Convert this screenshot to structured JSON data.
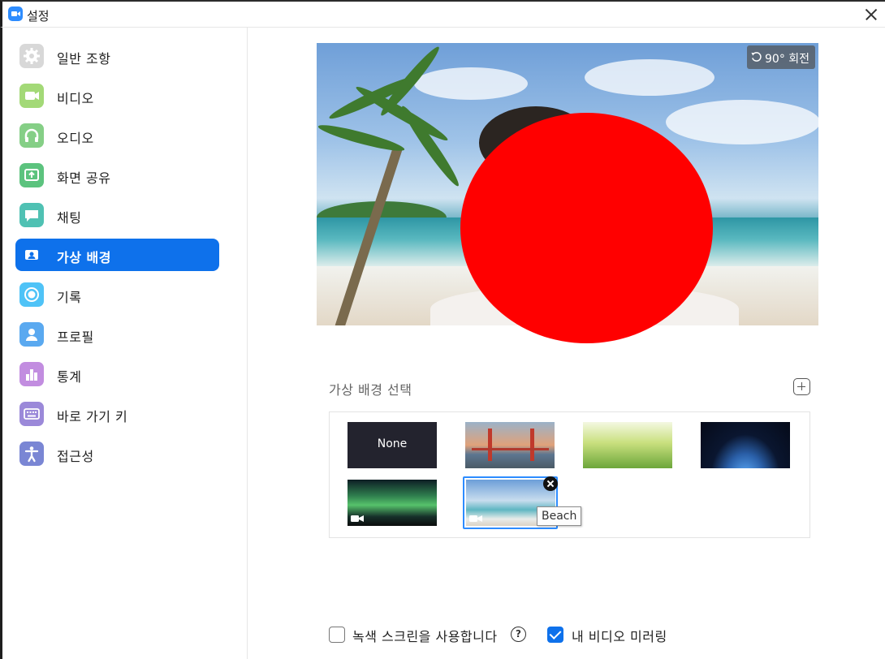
{
  "window": {
    "title": "설정"
  },
  "sidebar": {
    "items": [
      {
        "label": "일반 조항",
        "icon": "gear-icon",
        "active": false
      },
      {
        "label": "비디오",
        "icon": "video-icon",
        "active": false
      },
      {
        "label": "오디오",
        "icon": "headphones-icon",
        "active": false
      },
      {
        "label": "화면 공유",
        "icon": "screen-share-icon",
        "active": false
      },
      {
        "label": "채팅",
        "icon": "chat-bubble-icon",
        "active": false
      },
      {
        "label": "가상 배경",
        "icon": "virtual-background-icon",
        "active": true
      },
      {
        "label": "기록",
        "icon": "record-icon",
        "active": false
      },
      {
        "label": "프로필",
        "icon": "person-icon",
        "active": false
      },
      {
        "label": "통계",
        "icon": "bar-chart-icon",
        "active": false
      },
      {
        "label": "바로 가기 키",
        "icon": "keyboard-icon",
        "active": false
      },
      {
        "label": "접근성",
        "icon": "accessibility-icon",
        "active": false
      }
    ]
  },
  "preview": {
    "rotate_label": "90° 회전"
  },
  "backgrounds": {
    "section_title": "가상 배경 선택",
    "items": [
      {
        "label": "None",
        "type": "none"
      },
      {
        "label": "Golden Gate Bridge",
        "type": "image"
      },
      {
        "label": "Grass",
        "type": "image"
      },
      {
        "label": "Earth",
        "type": "image"
      },
      {
        "label": "Aurora",
        "type": "video"
      },
      {
        "label": "Beach",
        "type": "video",
        "selected": true
      }
    ],
    "tooltip": "Beach"
  },
  "options": {
    "green_screen_label": "녹색 스크린을 사용합니다",
    "green_screen_checked": false,
    "mirror_label": "내 비디오 미러링",
    "mirror_checked": true,
    "help_glyph": "?"
  },
  "colors": {
    "accent": "#0e71eb",
    "selection_border": "#2d8cff",
    "redaction": "#ff0000"
  }
}
